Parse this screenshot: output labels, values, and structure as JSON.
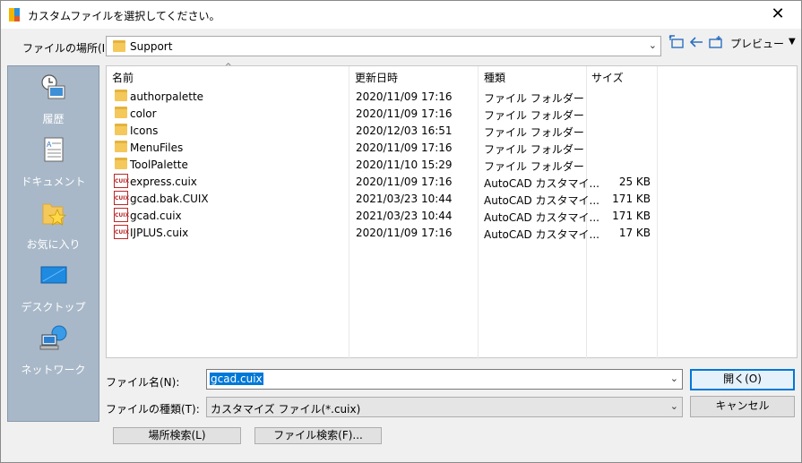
{
  "window": {
    "title": "カスタムファイルを選択してください。",
    "close_label": "✕"
  },
  "toolbar": {
    "look_in_label": "ファイルの場所(I):",
    "look_in_value": "Support",
    "preview_label": "プレビュー",
    "preview_arrow": "▼"
  },
  "places": [
    {
      "label": "履歴",
      "icon": "history-icon"
    },
    {
      "label": "ドキュメント",
      "icon": "documents-icon"
    },
    {
      "label": "お気に入り",
      "icon": "favorites-icon"
    },
    {
      "label": "デスクトップ",
      "icon": "desktop-icon"
    },
    {
      "label": "ネットワーク",
      "icon": "network-icon"
    }
  ],
  "columns": {
    "name": "名前",
    "modified": "更新日時",
    "type": "種類",
    "size": "サイズ"
  },
  "files": [
    {
      "name": "authorpalette",
      "modified": "2020/11/09 17:16",
      "type": "ファイル フォルダー",
      "size": "",
      "kind": "folder"
    },
    {
      "name": "color",
      "modified": "2020/11/09 17:16",
      "type": "ファイル フォルダー",
      "size": "",
      "kind": "folder"
    },
    {
      "name": "Icons",
      "modified": "2020/12/03 16:51",
      "type": "ファイル フォルダー",
      "size": "",
      "kind": "folder"
    },
    {
      "name": "MenuFiles",
      "modified": "2020/11/09 17:16",
      "type": "ファイル フォルダー",
      "size": "",
      "kind": "folder"
    },
    {
      "name": "ToolPalette",
      "modified": "2020/11/10 15:29",
      "type": "ファイル フォルダー",
      "size": "",
      "kind": "folder"
    },
    {
      "name": "express.cuix",
      "modified": "2020/11/09 17:16",
      "type": "AutoCAD カスタマイ...",
      "size": "25 KB",
      "kind": "cuix"
    },
    {
      "name": "gcad.bak.CUIX",
      "modified": "2021/03/23 10:44",
      "type": "AutoCAD カスタマイ...",
      "size": "171 KB",
      "kind": "cuix"
    },
    {
      "name": "gcad.cuix",
      "modified": "2021/03/23 10:44",
      "type": "AutoCAD カスタマイ...",
      "size": "171 KB",
      "kind": "cuix"
    },
    {
      "name": "IJPLUS.cuix",
      "modified": "2020/11/09 17:16",
      "type": "AutoCAD カスタマイ...",
      "size": "17 KB",
      "kind": "cuix"
    }
  ],
  "file_name": {
    "label": "ファイル名(N):",
    "value": "gcad.cuix"
  },
  "file_type": {
    "label": "ファイルの種類(T):",
    "value": "カスタマイズ ファイル(*.cuix)"
  },
  "buttons": {
    "open": "開く(O)",
    "cancel": "キャンセル",
    "locate": "場所検索(L)",
    "find_file": "ファイル検索(F)..."
  },
  "colors": {
    "selection": "#0078d7",
    "places_bg": "#a8b8c8",
    "folder": "#f4c85a",
    "cuix": "#b62a2a"
  }
}
